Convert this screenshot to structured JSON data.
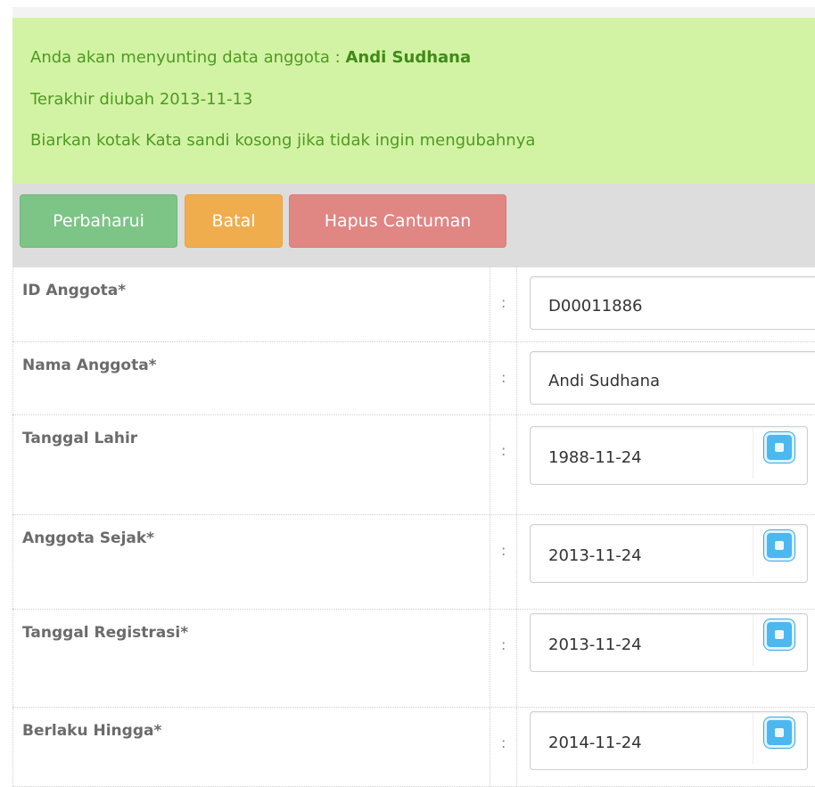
{
  "notice": {
    "line1_prefix": "Anda akan menyunting data anggota : ",
    "line1_name": "Andi Sudhana",
    "line2": "Terakhir diubah 2013-11-13",
    "line3": "Biarkan kotak Kata sandi kosong jika tidak ingin mengubahnya"
  },
  "actions": {
    "update_label": "Perbaharui",
    "cancel_label": "Batal",
    "delete_label": "Hapus Cantuman"
  },
  "form": {
    "separator": ":",
    "rows": [
      {
        "label": "ID Anggota*",
        "value": "D00011886"
      },
      {
        "label": "Nama Anggota*",
        "value": "Andi Sudhana"
      },
      {
        "label": "Tanggal Lahir",
        "value": "1988-11-24"
      },
      {
        "label": "Anggota Sejak*",
        "value": "2013-11-24"
      },
      {
        "label": "Tanggal Registrasi*",
        "value": "2013-11-24"
      },
      {
        "label": "Berlaku Hingga*",
        "value": "2014-11-24"
      }
    ],
    "calendar_icon": "calendar-icon"
  },
  "colors": {
    "notice_bg": "#d3f3a4",
    "notice_text": "#4d9a23",
    "update_button": "#7dc487",
    "cancel_button": "#f0ad4e",
    "delete_button": "#e08683",
    "calendar_button": "#4cb8ef"
  }
}
